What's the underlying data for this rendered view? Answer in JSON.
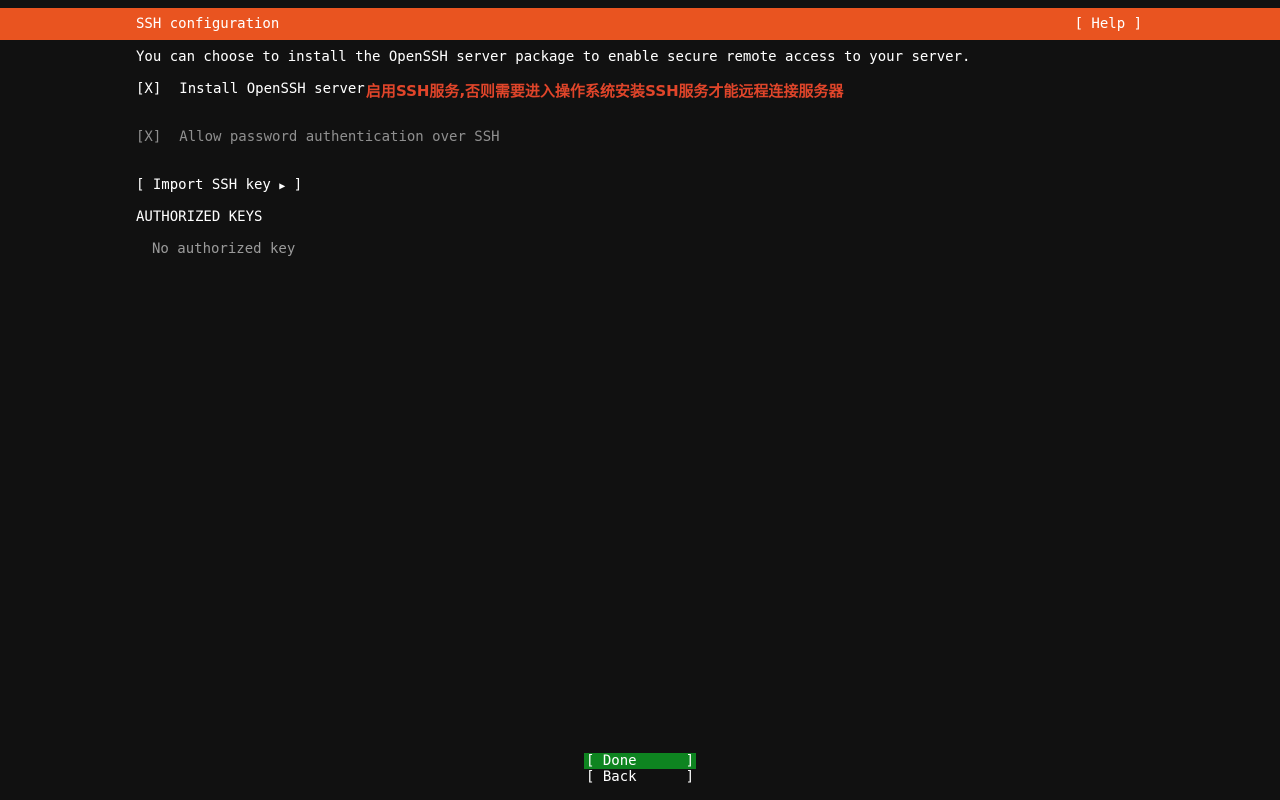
{
  "header": {
    "title": "SSH configuration",
    "help_label": "[ Help ]",
    "accent_color": "#e95420"
  },
  "intro_text": "You can choose to install the OpenSSH server package to enable secure remote access to your server.",
  "options": {
    "install": {
      "checkbox": "[X]",
      "label": "Install OpenSSH server",
      "checked": true
    },
    "allow_password": {
      "checkbox": "[X]",
      "label": "Allow password authentication over SSH",
      "checked": true
    }
  },
  "annotation": {
    "text": "启用SSH服务,否则需要进入操作系统安装SSH服务才能远程连接服务器",
    "color": "#e0452a"
  },
  "import_button": {
    "label": "[ Import SSH key ",
    "arrow": "▶",
    "close": " ]"
  },
  "authorized_keys": {
    "heading": "AUTHORIZED KEYS",
    "empty_message": "No authorized key"
  },
  "buttons": {
    "done": {
      "open": "[ Done",
      "close": "]"
    },
    "back": {
      "open": "[ Back",
      "close": "]"
    },
    "done_color": "#0e8420"
  }
}
